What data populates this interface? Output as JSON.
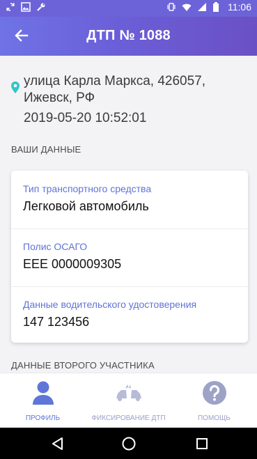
{
  "status": {
    "time": "11:06",
    "left_icons": [
      "sync-icon",
      "image-icon",
      "wrench-icon"
    ],
    "right_icons": [
      "vibrate-icon",
      "wifi-icon",
      "signal-icon",
      "battery-icon"
    ]
  },
  "header": {
    "title": "ДТП № 1088",
    "back_icon": "back-arrow-icon"
  },
  "incident": {
    "address": "улица Карла Маркса, 426057, Ижевск, РФ",
    "datetime": "2019-05-20 10:52:01",
    "location_icon": "location-pin-icon"
  },
  "section_your_data": "ВАШИ ДАННЫЕ",
  "your_data": {
    "vehicle_type_label": "Тип транспортного средства",
    "vehicle_type_value": "Легковой автомобиль",
    "policy_label": "Полис ОСАГО",
    "policy_value": "ЕЕЕ 0000009305",
    "license_label": "Данные водительского удостоверения",
    "license_value": "147 123456"
  },
  "section_second_participant": "ДАННЫЕ ВТОРОГО УЧАСТНИКА",
  "bottom_nav": {
    "tabs": [
      {
        "label": "ПРОФИЛЬ",
        "icon": "profile-icon",
        "active": true
      },
      {
        "label": "ФИКСИРОВАНИЕ ДТП",
        "icon": "car-crash-icon",
        "active": false
      },
      {
        "label": "ПОМОЩЬ",
        "icon": "help-icon",
        "active": false
      }
    ]
  },
  "android_nav": [
    "back-triangle-icon",
    "home-circle-icon",
    "recents-square-icon"
  ],
  "colors": {
    "accent": "#6b5fd8",
    "label_blue": "#5f73d6",
    "location_teal": "#32c6c6",
    "nav_inactive": "#9aa0c8"
  }
}
